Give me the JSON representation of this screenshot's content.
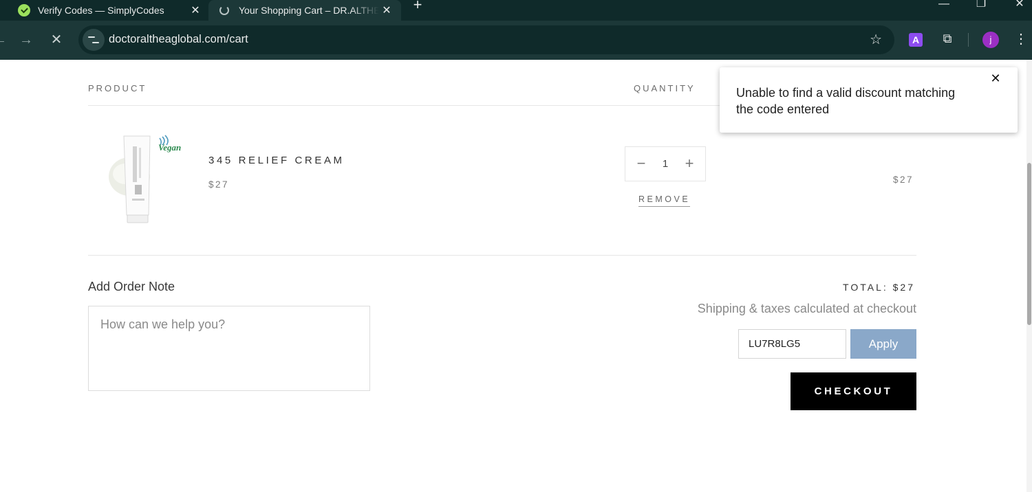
{
  "browser": {
    "tabs": [
      {
        "title": "Verify Codes — SimplyCodes",
        "close": "✕"
      },
      {
        "title": "Your Shopping Cart – DR.ALTHEA",
        "close": "✕"
      }
    ],
    "new_tab": "+",
    "window_controls": {
      "minimize": "—",
      "restore": "❐",
      "close": "✕"
    },
    "nav": {
      "back": "←",
      "forward": "→",
      "stop": "✕"
    },
    "url": "doctoraltheaglobal.com/cart",
    "bookmark_icon": "☆",
    "extension_a": "A",
    "extensions_icon": "⧉",
    "profile_initial": "j",
    "menu_icon": "⋮"
  },
  "cart": {
    "columns": {
      "product": "PRODUCT",
      "quantity": "QUANTITY"
    },
    "item": {
      "name": "345 RELIEF CREAM",
      "price": "$27",
      "quantity": "1",
      "line_total": "$27",
      "remove_label": "REMOVE",
      "badge_text": "Vegan"
    },
    "qty_minus": "−",
    "qty_plus": "+",
    "note_label": "Add Order Note",
    "note_placeholder": "How can we help you?",
    "total_label": "TOTAL: $27",
    "shipping_note": "Shipping & taxes calculated at checkout",
    "discount_code": "LU7R8LG5",
    "apply_label": "Apply",
    "checkout_label": "CHECKOUT"
  },
  "toast": {
    "message": "Unable to find a valid discount matching the code entered",
    "close": "✕"
  },
  "colors": {
    "chrome_dark": "#0f2a2a",
    "chrome_toolbar": "#1c3838",
    "apply_button": "#8aa8c9",
    "checkout_button": "#000000",
    "vegan_badge": "#2c8a4f"
  }
}
